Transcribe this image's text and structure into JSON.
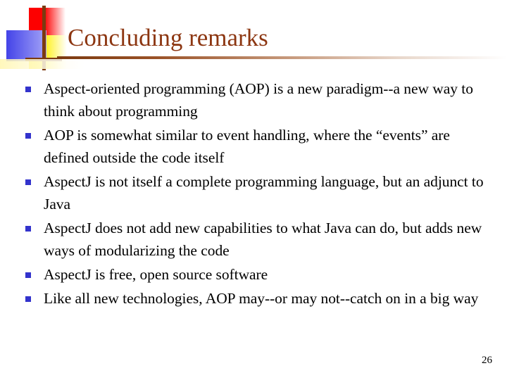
{
  "slide": {
    "title": "Concluding remarks",
    "page_number": "26",
    "title_color": "#8c3611",
    "bullet_color": "#3333cc",
    "rule_color": "#7b3a10",
    "body_color": "#000000",
    "background_color": "#ffffff"
  },
  "decoration": {
    "red_square_color": "#fd0000",
    "blue_square_color": "#4343e8",
    "yellow_square_color": "#ffef00",
    "cross_line_color": "#7b3a10"
  },
  "bullets": [
    {
      "text": "Aspect-oriented programming (AOP) is a new paradigm--a new way to think about programming"
    },
    {
      "text": "AOP is somewhat similar to event handling, where the “events” are defined outside the code itself"
    },
    {
      "text": "AspectJ is not itself a complete programming language, but an adjunct to Java"
    },
    {
      "text": "AspectJ does not add new capabilities to what Java can do, but adds new ways of modularizing the code"
    },
    {
      "text": "AspectJ is free, open source software"
    },
    {
      "text": "Like all new technologies, AOP may--or may not--catch on in a big way"
    }
  ]
}
